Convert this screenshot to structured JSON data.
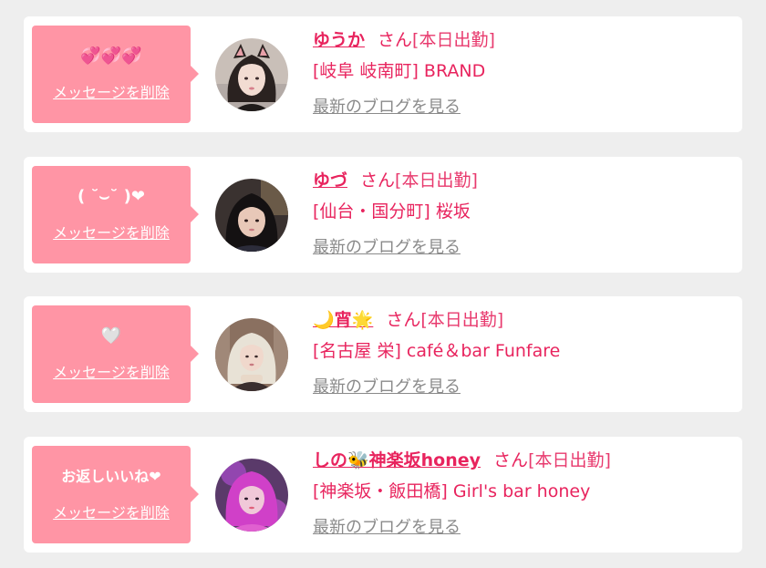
{
  "colors": {
    "background": "#eeeeee",
    "bubble": "#ff95a5",
    "accent": "#e8245e",
    "link_gray": "#8a8a8a"
  },
  "cards": [
    {
      "message": "💞💞💞",
      "delete_label": "メッセージを削除",
      "name": "ゆうか",
      "honorific": "さん",
      "status": "[本日出勤]",
      "shop": "[岐阜 岐南町] BRAND",
      "blog_label": "最新のブログを見る",
      "avatar_icon": "girl-photo-with-cat-ears"
    },
    {
      "message": "( ˘⌣˘ )❤",
      "delete_label": "メッセージを削除",
      "name": "ゆづ",
      "honorific": "さん",
      "status": "[本日出勤]",
      "shop": "[仙台・国分町] 桜坂",
      "blog_label": "最新のブログを見る",
      "avatar_icon": "girl-photo-dark-hair"
    },
    {
      "message": "🤍",
      "delete_label": "メッセージを削除",
      "name": "🌙宵🌟",
      "honorific": "さん",
      "status": "[本日出勤]",
      "shop": "[名古屋 栄] café＆bar Funfare",
      "blog_label": "最新のブログを見る",
      "avatar_icon": "girl-photo-blonde-hair"
    },
    {
      "message": "お返しいいね❤",
      "delete_label": "メッセージを削除",
      "name": "しの🐝神楽坂honey",
      "honorific": "さん",
      "status": "[本日出勤]",
      "shop": "[神楽坂・飯田橋] Girl's bar honey",
      "blog_label": "最新のブログを見る",
      "avatar_icon": "girl-photo-pink-hair"
    }
  ]
}
